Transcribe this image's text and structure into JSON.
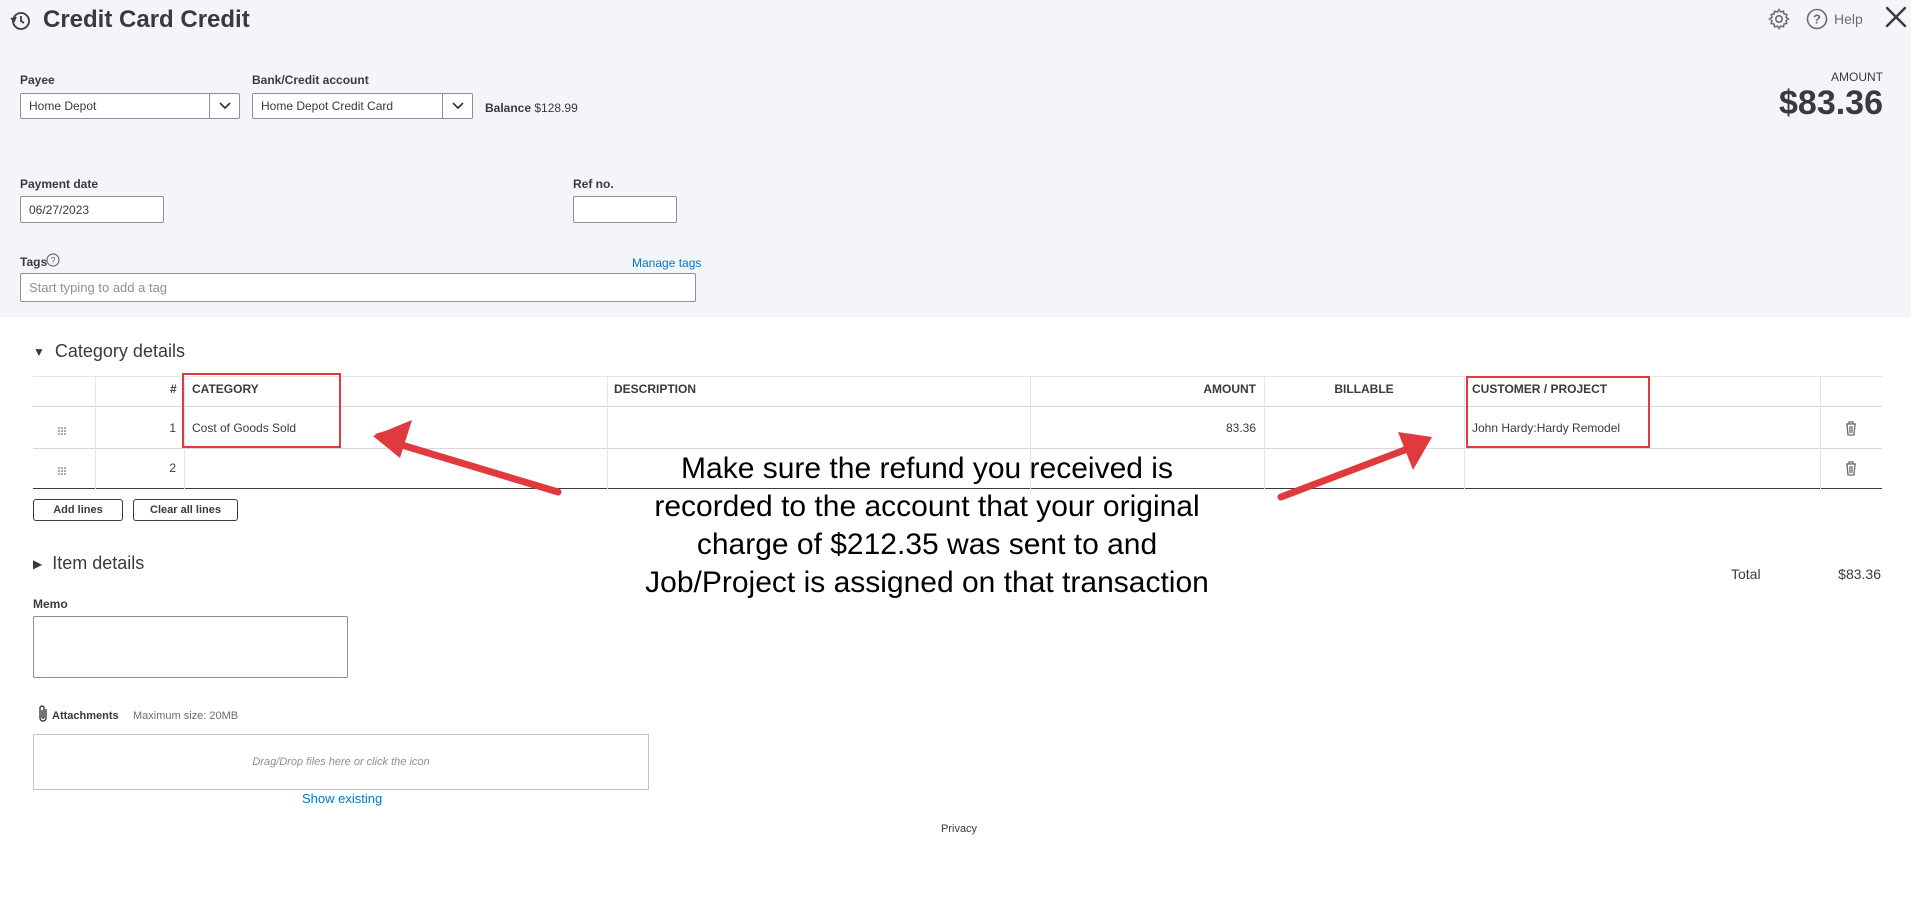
{
  "header": {
    "title": "Credit Card Credit",
    "help_label": "Help"
  },
  "form": {
    "payee_label": "Payee",
    "payee_value": "Home Depot",
    "bank_label": "Bank/Credit account",
    "bank_value": "Home Depot Credit Card",
    "balance_label": "Balance",
    "balance_value": "$128.99",
    "amount_label": "AMOUNT",
    "amount_value": "$83.36",
    "payment_date_label": "Payment date",
    "payment_date_value": "06/27/2023",
    "ref_label": "Ref no.",
    "ref_value": "",
    "tags_label": "Tags",
    "manage_tags": "Manage tags",
    "tags_placeholder": "Start typing to add a tag"
  },
  "category_details": {
    "title": "Category details",
    "columns": [
      "#",
      "CATEGORY",
      "DESCRIPTION",
      "AMOUNT",
      "BILLABLE",
      "CUSTOMER / PROJECT"
    ],
    "rows": [
      {
        "num": "1",
        "category": "Cost of Goods Sold",
        "description": "",
        "amount": "83.36",
        "billable": "",
        "customer": "John Hardy:Hardy Remodel"
      },
      {
        "num": "2",
        "category": "",
        "description": "",
        "amount": "",
        "billable": "",
        "customer": ""
      }
    ],
    "add_lines": "Add lines",
    "clear_lines": "Clear all lines"
  },
  "item_details": {
    "title": "Item details"
  },
  "totals": {
    "total_label": "Total",
    "total_value": "$83.36"
  },
  "memo": {
    "label": "Memo",
    "value": ""
  },
  "attachments": {
    "label": "Attachments",
    "max_size": "Maximum size: 20MB",
    "drop_text": "Drag/Drop files here or click the icon",
    "show_existing": "Show existing"
  },
  "footer": {
    "privacy": "Privacy"
  },
  "annotation": {
    "lines": [
      "Make sure the refund you received is",
      "recorded to the account that your original",
      "charge of $212.35 was sent to and",
      "Job/Project is assigned on that transaction"
    ]
  },
  "colors": {
    "accent_link": "#0077c5",
    "annotation_red": "#e0393e",
    "header_bg": "#f4f5f8"
  }
}
